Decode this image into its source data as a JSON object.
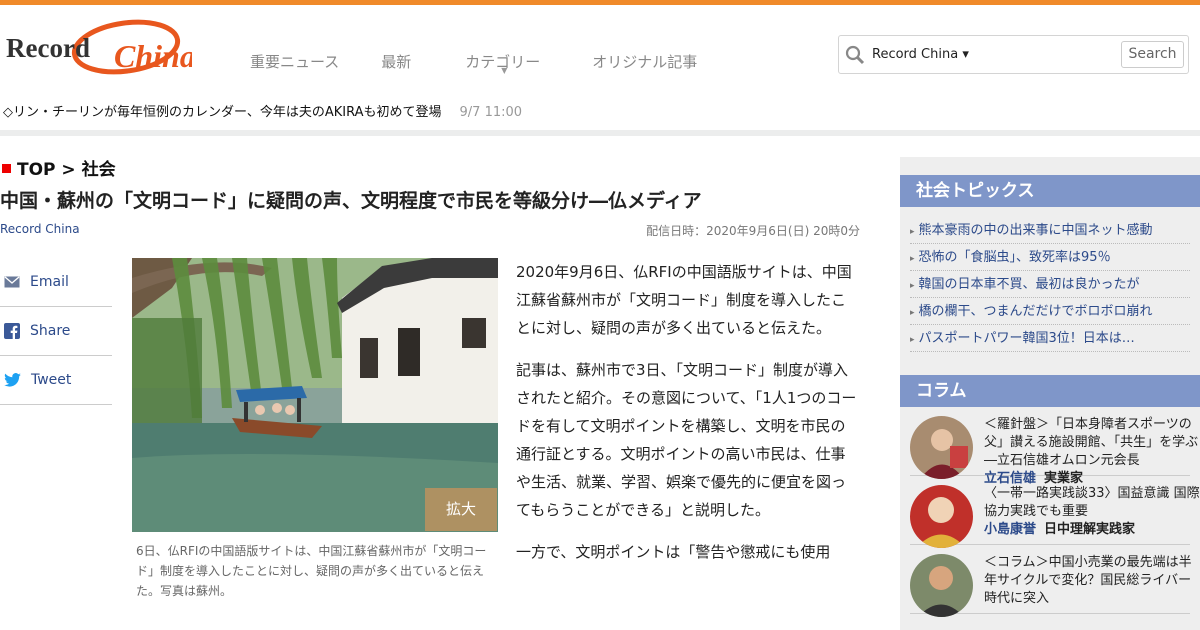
{
  "brand": {
    "logo_text_1": "Record",
    "logo_text_2": "China"
  },
  "nav": [
    {
      "label": "重要ニュース"
    },
    {
      "label": "最新"
    },
    {
      "label": "カテゴリー"
    },
    {
      "label": "オリジナル記事"
    }
  ],
  "search": {
    "scope": "Record China ▾",
    "button": "Search"
  },
  "ticker": {
    "text": "◇リン・チーリンが毎年恒例のカレンダー、今年は夫のAKIRAも初めて登場",
    "time": "9/7 11:00"
  },
  "breadcrumb": "TOP > 社会",
  "article": {
    "title": "中国・蘇州の「文明コード」に疑問の声、文明程度で市民を等級分け―仏メディア",
    "source": "Record China",
    "date": "配信日時：2020年9月6日(日) 20時0分",
    "enlarge": "拡大",
    "caption": "6日、仏RFIの中国語版サイトは、中国江蘇省蘇州市が「文明コード」制度を導入したことに対し、疑問の声が多く出ていると伝えた。写真は蘇州。",
    "paragraphs": [
      "2020年9月6日、仏RFIの中国語版サイトは、中国江蘇省蘇州市が「文明コード」制度を導入したことに対し、疑問の声が多く出ていると伝えた。",
      "記事は、蘇州市で3日、「文明コード」制度が導入されたと紹介。その意図について、「1人1つのコードを有して文明ポイントを構築し、文明を市民の通行証とする。文明ポイントの高い市民は、仕事や生活、就業、学習、娯楽で優先的に便宜を図ってもらうことができる」と説明した。",
      "一方で、文明ポイントは「警告や懲戒にも使用"
    ]
  },
  "share": [
    {
      "label": "Email",
      "icon": "mail-icon"
    },
    {
      "label": "Share",
      "icon": "facebook-icon"
    },
    {
      "label": "Tweet",
      "icon": "twitter-icon"
    }
  ],
  "sidebar": {
    "topics_title": "社会トピックス",
    "topics": [
      "熊本豪雨の中の出来事に中国ネット感動",
      "恐怖の「食脳虫」、致死率は95％",
      "韓国の日本車不買、最初は良かったが",
      "橋の欄干、つまんだだけでボロボロ崩れ",
      "パスポートパワー韓国3位！日本は…"
    ],
    "column_title": "コラム",
    "columns": [
      {
        "text": "＜羅針盤＞「日本身障者スポーツの父」讃える施設開館、「共生」を学ぶ―立石信雄オムロン元会長",
        "author": "立石信雄",
        "role": "実業家"
      },
      {
        "text": "〈一帯一路実践談33〉国益意識 国際協力実践でも重要",
        "author": "小島康誉",
        "role": "日中理解実践家"
      },
      {
        "text": "＜コラム＞中国小売業の最先端は半年サイクルで変化？国民総ライバー時代に突入",
        "author": "",
        "role": ""
      }
    ]
  },
  "colors": {
    "accent_orange": "#f08a2a",
    "link_blue": "#2c4a8a",
    "sidebar_head": "#7f96c9"
  }
}
